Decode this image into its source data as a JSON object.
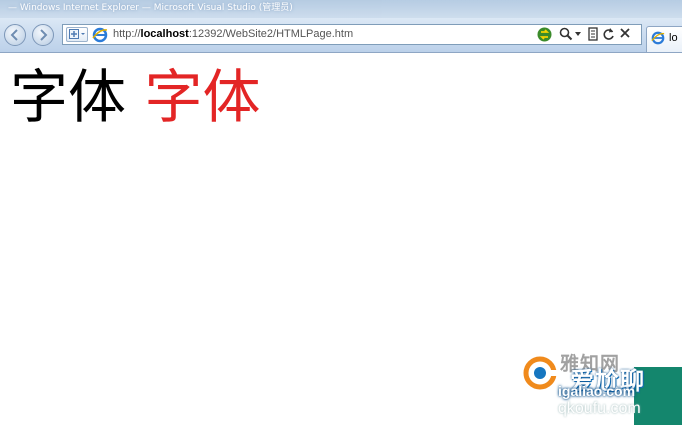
{
  "window": {
    "title": "— Windows Internet Explorer — Microsoft Visual Studio (管理员)"
  },
  "address": {
    "scheme": "http://",
    "host": "localhost",
    "rest": ":12392/WebSite2/HTMLPage.htm"
  },
  "tab": {
    "label": "lo"
  },
  "content": {
    "text_black": "字体",
    "text_red": "字体",
    "red_color": "#e32525"
  },
  "watermark": {
    "line1": "雅知网",
    "line2": "爱尬聊",
    "line3": "igaliao.com",
    "line4": "qkoufu.com"
  },
  "icons": [
    "back-icon",
    "forward-icon",
    "compat-view-icon",
    "ie-page-icon",
    "refresh-go-icon",
    "search-icon",
    "dropdown-icon",
    "feeds-icon",
    "refresh-icon",
    "stop-icon",
    "ie-tab-icon"
  ]
}
